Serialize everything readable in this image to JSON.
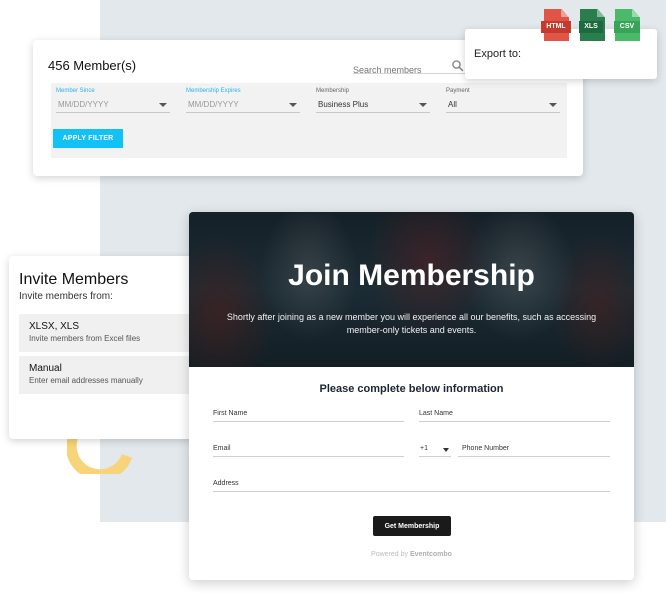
{
  "members": {
    "title": "456 Member(s)",
    "search_placeholder": "Search members",
    "filters": [
      {
        "label": "Member Since",
        "value": "MM/DD/YYYY"
      },
      {
        "label": "Membership Expires",
        "value": "MM/DD/YYYY"
      },
      {
        "label": "Membership",
        "value": "Business Plus"
      },
      {
        "label": "Payment",
        "value": "All"
      }
    ],
    "apply_label": "APPLY FILTER"
  },
  "export": {
    "label": "Export to:",
    "formats": [
      "HTML",
      "XLS",
      "CSV"
    ]
  },
  "invite": {
    "title": "Invite Members",
    "subtitle": "Invite members from:",
    "options": [
      {
        "title": "XLSX, XLS",
        "desc": "Invite members from Excel files"
      },
      {
        "title": "Manual",
        "desc": "Enter email addresses manually"
      }
    ]
  },
  "join": {
    "title": "Join Membership",
    "description": "Shortly after joining as a new member you will experience all our benefits, such as accessing member-only tickets and events.",
    "form_heading": "Please complete below information",
    "fields": {
      "first_name": "First Name",
      "last_name": "Last Name",
      "email": "Email",
      "country_code": "+1",
      "phone": "Phone Number",
      "address": "Address"
    },
    "submit_label": "Get Membership",
    "powered_prefix": "Powered by",
    "powered_brand": "Eventcombo"
  },
  "colors": {
    "accent_button": "#13c2f5",
    "filter_label_blue": "#2ab3ea",
    "decor_arc": "#f7d47a",
    "html_red": "#e05546",
    "xls_green": "#2a7d4c",
    "csv_green": "#4bb86a"
  }
}
